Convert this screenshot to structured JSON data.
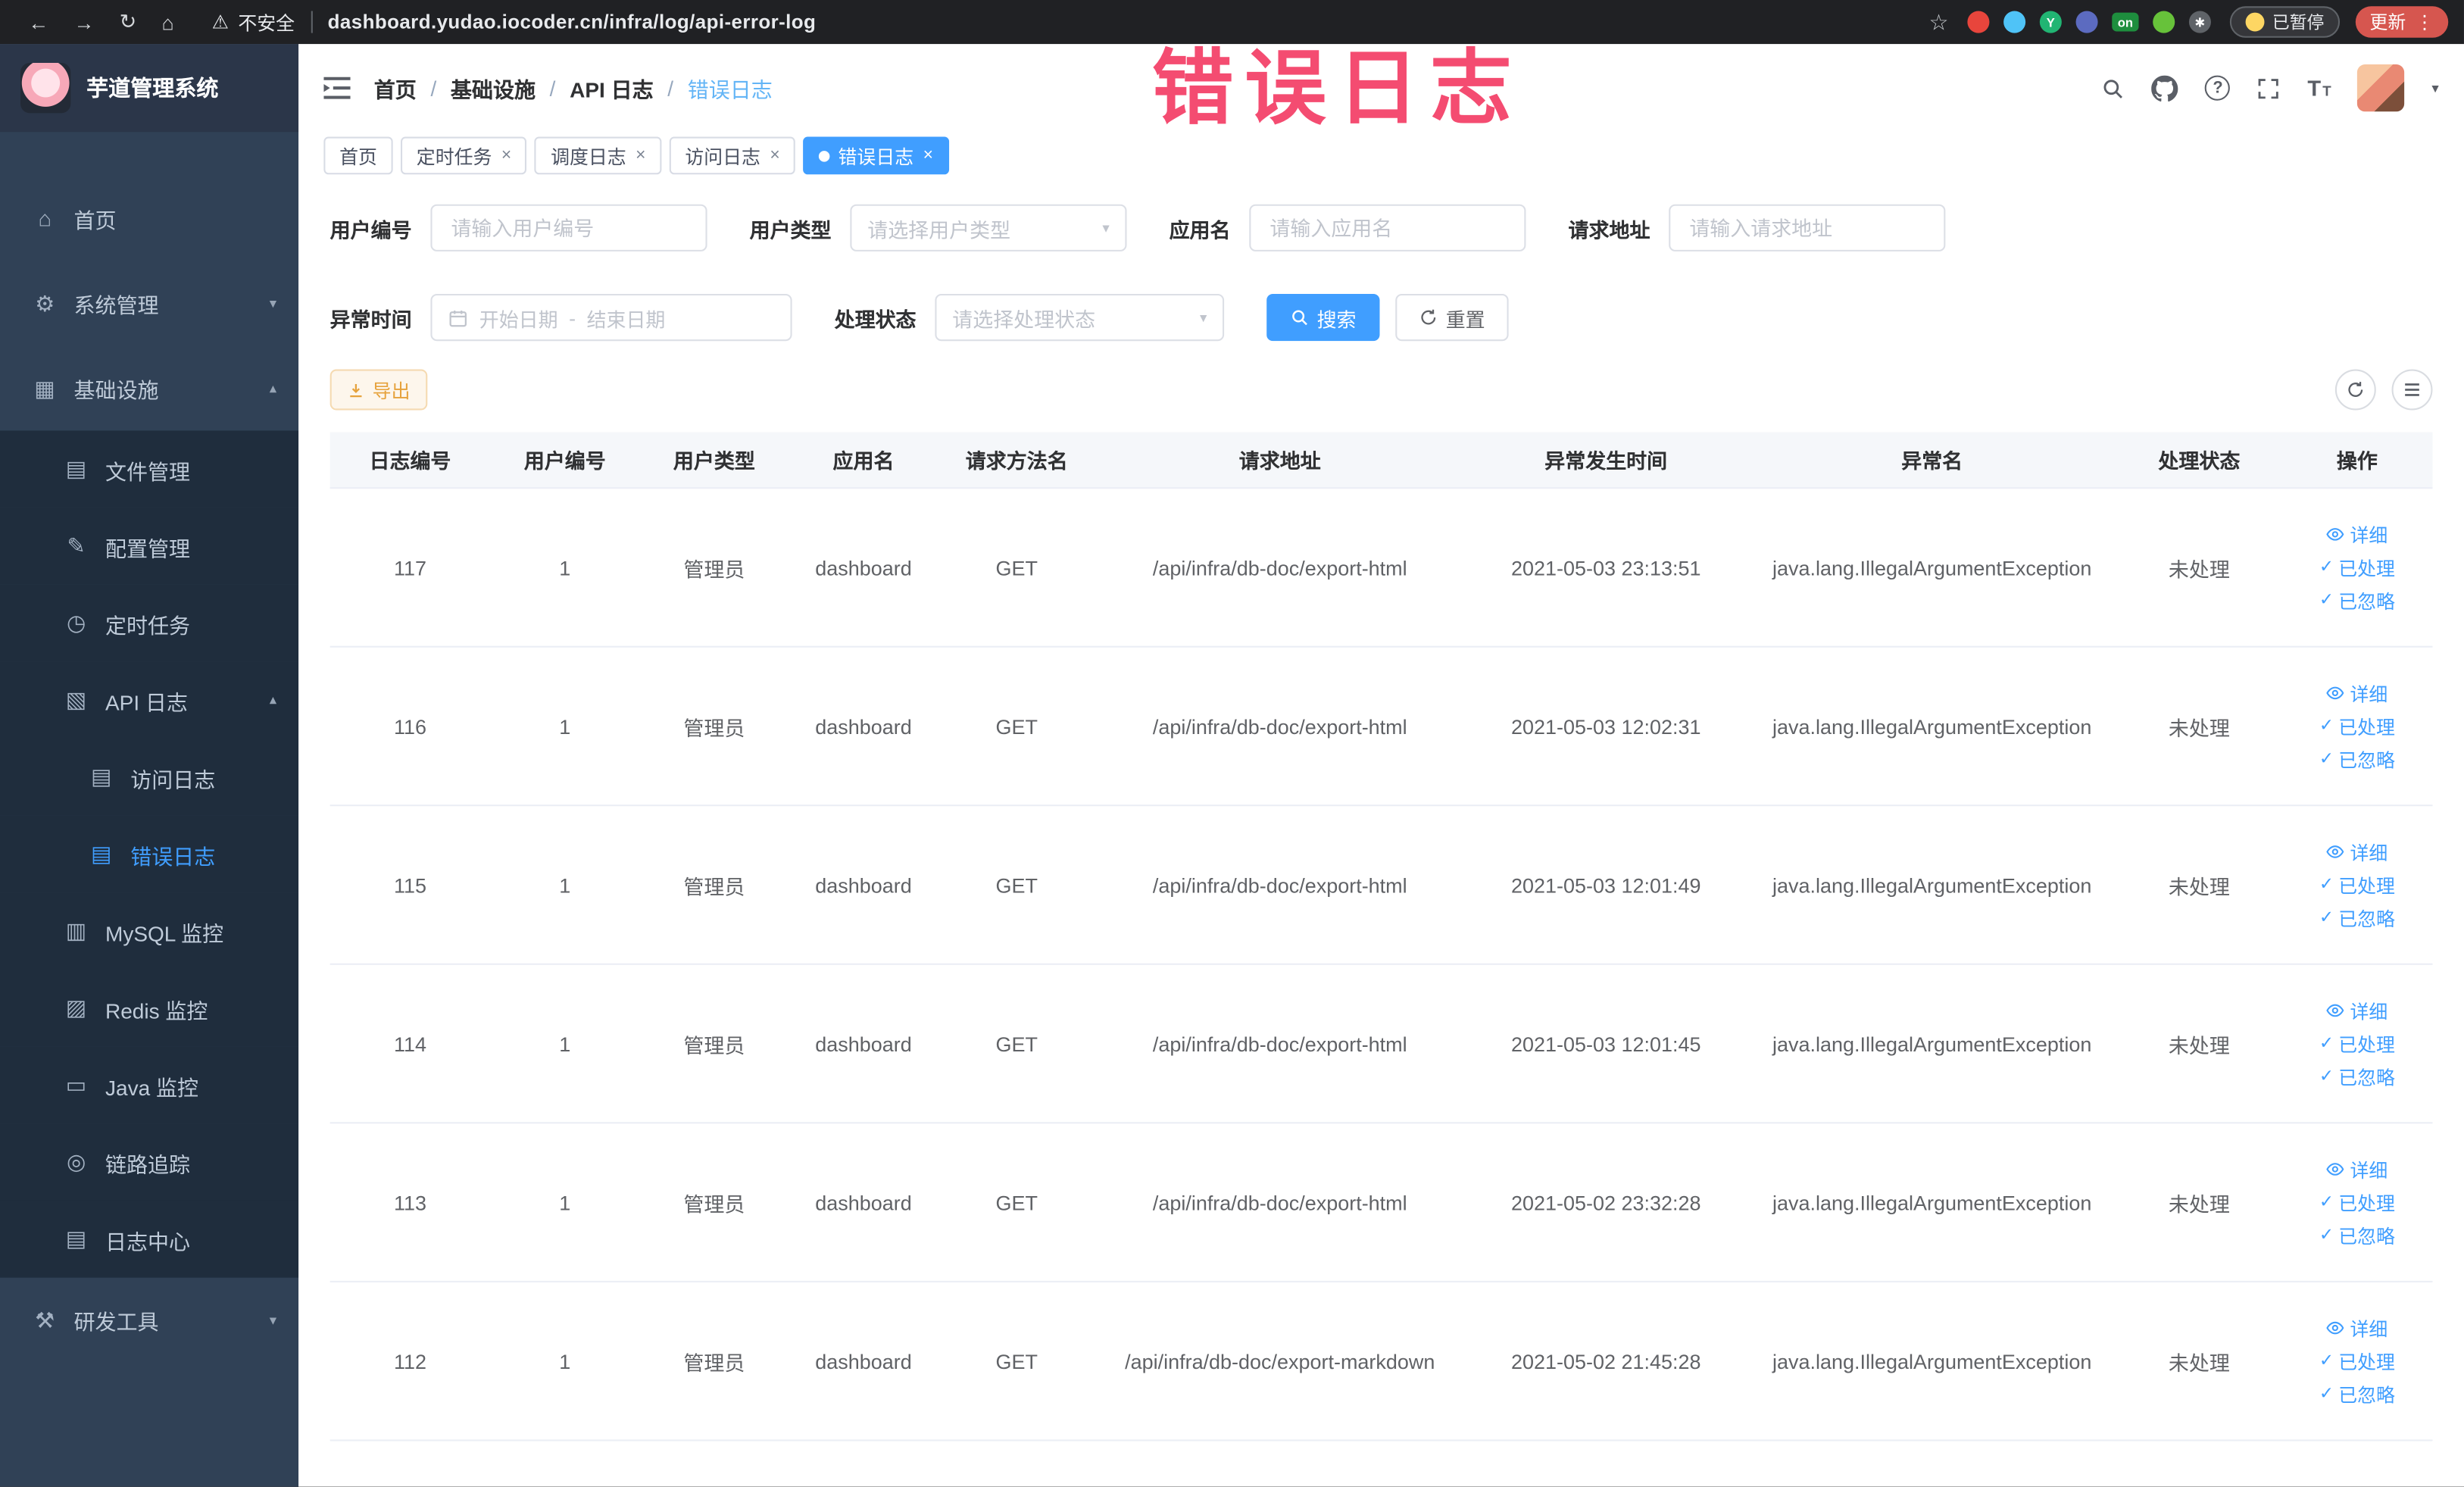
{
  "glyphs": {
    "back": "←",
    "forward": "→",
    "reload": "↻",
    "home": "⌂",
    "warning": "⚠",
    "star": "☆",
    "kebab": "⋮",
    "close": "×",
    "separator": "/",
    "caret": "▾",
    "caret_up": "▴",
    "check": "✓",
    "question": "?",
    "font": "T"
  },
  "browser": {
    "security_label": "不安全",
    "url": "dashboard.yudao.iocoder.cn/infra/log/api-error-log",
    "paused_label": "已暂停",
    "update_label": "更新",
    "extensions": [
      {
        "name": "ext-red",
        "color": "#e8453c"
      },
      {
        "name": "ext-lightblue",
        "color": "#4fc3f7"
      },
      {
        "name": "ext-green",
        "color": "#21b573",
        "text": "Y"
      },
      {
        "name": "ext-indigo",
        "color": "#5c6bc0"
      },
      {
        "name": "ext-on-badge",
        "color": "#1e8e3e",
        "text": "on",
        "shape": "square"
      },
      {
        "name": "ext-leaf",
        "color": "#67c23a"
      },
      {
        "name": "ext-star",
        "color": "#5f6368",
        "text": "✱"
      }
    ]
  },
  "overlay_text": "错误日志",
  "icons": {
    "home": "⌂",
    "gear": "⚙",
    "infra": "▦",
    "file": "▤",
    "config": "✎",
    "timer": "◷",
    "api": "▧",
    "doc": "▤",
    "mysql": "▥",
    "redis": "▨",
    "java": "▭",
    "trace": "◎",
    "log": "▤",
    "tools": "⚒"
  },
  "sidebar": {
    "logo_title": "芋道管理系统",
    "items": [
      {
        "key": "home",
        "label": "首页",
        "icon": "home",
        "level": 1
      },
      {
        "key": "system-mgmt",
        "label": "系统管理",
        "icon": "gear",
        "level": 1,
        "chevron": "down"
      },
      {
        "key": "infrastructure",
        "label": "基础设施",
        "icon": "infra",
        "level": 1,
        "chevron": "up"
      },
      {
        "key": "file-mgmt",
        "label": "文件管理",
        "icon": "file",
        "level": 2,
        "sub": true
      },
      {
        "key": "config-mgmt",
        "label": "配置管理",
        "icon": "config",
        "level": 2,
        "sub": true
      },
      {
        "key": "scheduled-tasks",
        "label": "定时任务",
        "icon": "timer",
        "level": 2,
        "sub": true
      },
      {
        "key": "api-log",
        "label": "API 日志",
        "icon": "api",
        "level": 2,
        "sub": true,
        "chevron": "up"
      },
      {
        "key": "access-log",
        "label": "访问日志",
        "icon": "doc",
        "level": 3,
        "sub": true
      },
      {
        "key": "error-log",
        "label": "错误日志",
        "icon": "doc",
        "level": 3,
        "sub": true,
        "active": true
      },
      {
        "key": "mysql-monitor",
        "label": "MySQL 监控",
        "icon": "mysql",
        "level": 2,
        "sub": true
      },
      {
        "key": "redis-monitor",
        "label": "Redis 监控",
        "icon": "redis",
        "level": 2,
        "sub": true
      },
      {
        "key": "java-monitor",
        "label": "Java 监控",
        "icon": "java",
        "level": 2,
        "sub": true
      },
      {
        "key": "trace",
        "label": "链路追踪",
        "icon": "trace",
        "level": 2,
        "sub": true
      },
      {
        "key": "log-center",
        "label": "日志中心",
        "icon": "log",
        "level": 2,
        "sub": true
      },
      {
        "key": "dev-tools",
        "label": "研发工具",
        "icon": "tools",
        "level": 1,
        "chevron": "down"
      }
    ]
  },
  "breadcrumb": [
    "首页",
    "基础设施",
    "API 日志",
    "错误日志"
  ],
  "tabs": [
    {
      "key": "home",
      "label": "首页",
      "closable": false,
      "active": false
    },
    {
      "key": "scheduled-tasks",
      "label": "定时任务",
      "closable": true,
      "active": false
    },
    {
      "key": "job-log",
      "label": "调度日志",
      "closable": true,
      "active": false
    },
    {
      "key": "access-log",
      "label": "访问日志",
      "closable": true,
      "active": false
    },
    {
      "key": "error-log",
      "label": "错误日志",
      "closable": true,
      "active": true
    }
  ],
  "filters": {
    "user_id_label": "用户编号",
    "user_id_placeholder": "请输入用户编号",
    "user_type_label": "用户类型",
    "user_type_placeholder": "请选择用户类型",
    "app_name_label": "应用名",
    "app_name_placeholder": "请输入应用名",
    "request_url_label": "请求地址",
    "request_url_placeholder": "请输入请求地址",
    "exception_time_label": "异常时间",
    "start_date_placeholder": "开始日期",
    "range_separator": "-",
    "end_date_placeholder": "结束日期",
    "process_status_label": "处理状态",
    "process_status_placeholder": "请选择处理状态",
    "search_label": "搜索",
    "reset_label": "重置"
  },
  "toolbar": {
    "export_label": "导出"
  },
  "table": {
    "headers": [
      "日志编号",
      "用户编号",
      "用户类型",
      "应用名",
      "请求方法名",
      "请求地址",
      "异常发生时间",
      "异常名",
      "处理状态",
      "操作"
    ],
    "action_labels": {
      "detail": "详细",
      "processed": "已处理",
      "ignored": "已忽略"
    },
    "rows": [
      {
        "id": "117",
        "user_id": "1",
        "user_type": "管理员",
        "app": "dashboard",
        "method": "GET",
        "url": "/api/infra/db-doc/export-html",
        "time": "2021-05-03 23:13:51",
        "exception": "java.lang.IllegalArgumentException",
        "status": "未处理"
      },
      {
        "id": "116",
        "user_id": "1",
        "user_type": "管理员",
        "app": "dashboard",
        "method": "GET",
        "url": "/api/infra/db-doc/export-html",
        "time": "2021-05-03 12:02:31",
        "exception": "java.lang.IllegalArgumentException",
        "status": "未处理"
      },
      {
        "id": "115",
        "user_id": "1",
        "user_type": "管理员",
        "app": "dashboard",
        "method": "GET",
        "url": "/api/infra/db-doc/export-html",
        "time": "2021-05-03 12:01:49",
        "exception": "java.lang.IllegalArgumentException",
        "status": "未处理"
      },
      {
        "id": "114",
        "user_id": "1",
        "user_type": "管理员",
        "app": "dashboard",
        "method": "GET",
        "url": "/api/infra/db-doc/export-html",
        "time": "2021-05-03 12:01:45",
        "exception": "java.lang.IllegalArgumentException",
        "status": "未处理"
      },
      {
        "id": "113",
        "user_id": "1",
        "user_type": "管理员",
        "app": "dashboard",
        "method": "GET",
        "url": "/api/infra/db-doc/export-html",
        "time": "2021-05-02 23:32:28",
        "exception": "java.lang.IllegalArgumentException",
        "status": "未处理"
      },
      {
        "id": "112",
        "user_id": "1",
        "user_type": "管理员",
        "app": "dashboard",
        "method": "GET",
        "url": "/api/infra/db-doc/export-markdown",
        "time": "2021-05-02 21:45:28",
        "exception": "java.lang.IllegalArgumentException",
        "status": "未处理"
      }
    ]
  }
}
